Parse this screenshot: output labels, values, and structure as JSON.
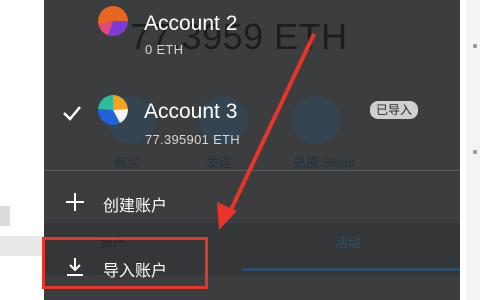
{
  "background_wallet": {
    "balance": "77.3959 ETH",
    "actions": [
      {
        "label": "购买",
        "icon": "download-icon"
      },
      {
        "label": "发送",
        "icon": "send-icon"
      },
      {
        "label": "兑换 Swap",
        "icon": "swap-icon"
      }
    ],
    "tabs": [
      {
        "label": "资产"
      },
      {
        "label": "活动",
        "active": true
      }
    ]
  },
  "account_menu": {
    "accounts": [
      {
        "name": "Account 2",
        "balance": "0 ETH",
        "selected": false,
        "badge": ""
      },
      {
        "name": "Account 3",
        "balance": "77.395901 ETH",
        "selected": true,
        "badge": "已导入"
      }
    ],
    "actions": [
      {
        "label": "创建账户",
        "icon": "plus-icon"
      },
      {
        "label": "导入账户",
        "icon": "import-icon",
        "highlighted": true
      }
    ]
  },
  "colors": {
    "panel": "#3c3d3e",
    "annotation": "#e8342a",
    "accent": "#2c4d69"
  }
}
